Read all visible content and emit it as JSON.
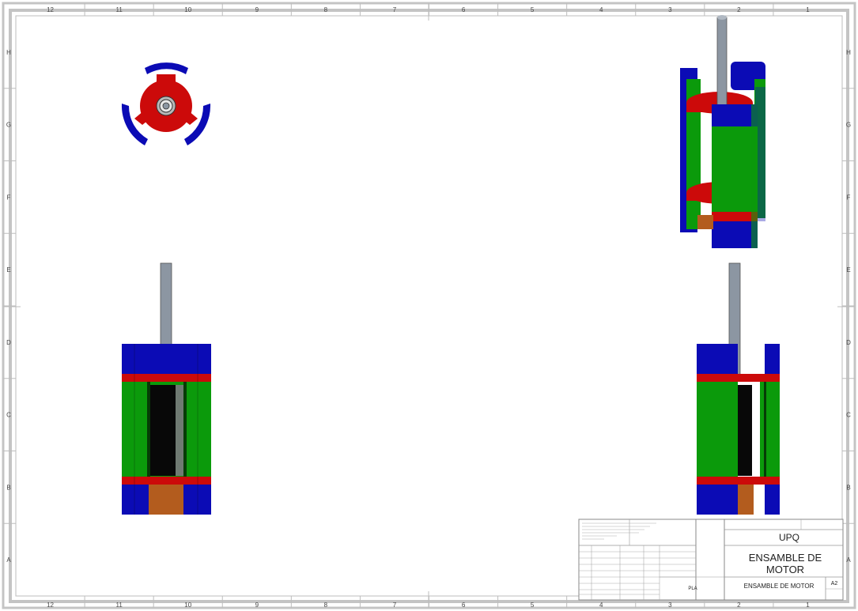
{
  "sheet": {
    "column_labels": [
      "12",
      "11",
      "10",
      "9",
      "8",
      "7",
      "6",
      "5",
      "4",
      "3",
      "2",
      "1"
    ],
    "row_labels": [
      "H",
      "G",
      "F",
      "E",
      "D",
      "C",
      "B",
      "A"
    ]
  },
  "views": {
    "top_view": "top-view",
    "isometric_view": "isometric-view",
    "front_view": "front-view",
    "side_view": "side-view"
  },
  "title_block": {
    "company": "UPQ",
    "title": "ENSAMBLE DE MOTOR",
    "drawing_number": "ENSAMBLE DE MOTOR",
    "size": "A2",
    "material": "PLA"
  },
  "colors": {
    "magnet_blue": "#0b0bb5",
    "rotor_red": "#cc0a0a",
    "coil_green": "#0b9a0b",
    "shaft_gray": "#8c96a2",
    "core_black": "#080808",
    "base_brown": "#b35c1e",
    "frame_gray": "#c8c8c8"
  }
}
